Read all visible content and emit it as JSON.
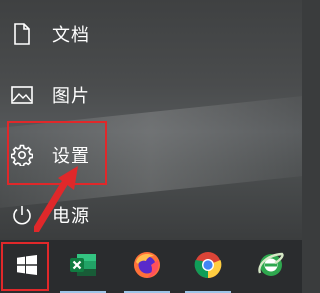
{
  "start_menu": {
    "items": [
      {
        "label": "文档",
        "icon": "document-icon"
      },
      {
        "label": "图片",
        "icon": "picture-icon"
      },
      {
        "label": "设置",
        "icon": "gear-icon"
      },
      {
        "label": "电源",
        "icon": "power-icon"
      }
    ]
  },
  "taskbar": {
    "apps": [
      {
        "icon": "windows-start-icon"
      },
      {
        "icon": "excel-icon"
      },
      {
        "icon": "firefox-icon"
      },
      {
        "icon": "chrome-icon"
      },
      {
        "icon": "internet-explorer-icon"
      }
    ]
  },
  "annotation": {
    "highlight_color": "#e0282a"
  }
}
